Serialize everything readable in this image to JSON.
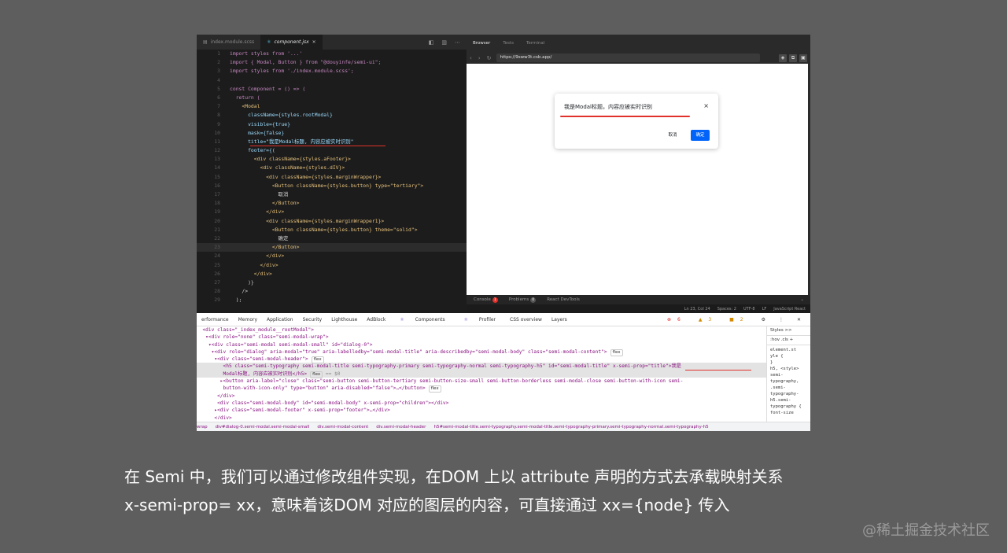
{
  "editor": {
    "tabs": [
      "index.module.scss",
      "component.jsx"
    ],
    "tab_close": "×",
    "lines": [
      {
        "n": "1",
        "text": "import styles from '...'"
      },
      {
        "n": "2",
        "text": "import { Modal, Button } from \"@douyinfe/semi-ui\";"
      },
      {
        "n": "3",
        "text": "import styles from './index.module.scss';"
      },
      {
        "n": "4",
        "text": ""
      },
      {
        "n": "5",
        "text": "const Component = () => ("
      },
      {
        "n": "6",
        "text": "  return ("
      },
      {
        "n": "7",
        "text": "    <Modal"
      },
      {
        "n": "8",
        "text": "      className={styles.rootModal}"
      },
      {
        "n": "9",
        "text": "      visible={true}"
      },
      {
        "n": "10",
        "text": "      mask={false}"
      },
      {
        "n": "11",
        "text": "      title=\"我是Modal标题, 内容应被实时识别\""
      },
      {
        "n": "12",
        "text": "      footer={("
      },
      {
        "n": "13",
        "text": "        <div className={styles.aFooter}>"
      },
      {
        "n": "14",
        "text": "          <div className={styles.dIV}>"
      },
      {
        "n": "15",
        "text": "            <div className={styles.marginWrapper}>"
      },
      {
        "n": "16",
        "text": "              <Button className={styles.button} type=\"tertiary\">"
      },
      {
        "n": "17",
        "text": "                取消"
      },
      {
        "n": "18",
        "text": "              </Button>"
      },
      {
        "n": "19",
        "text": "            </div>"
      },
      {
        "n": "20",
        "text": "            <div className={styles.marginWrapper1}>"
      },
      {
        "n": "21",
        "text": "              <Button className={styles.button} theme=\"solid\">"
      },
      {
        "n": "22",
        "text": "                确定"
      },
      {
        "n": "23",
        "text": "              </Button>"
      },
      {
        "n": "24",
        "text": "            </div>"
      },
      {
        "n": "25",
        "text": "          </div>"
      },
      {
        "n": "26",
        "text": "        </div>"
      },
      {
        "n": "27",
        "text": "      )}"
      },
      {
        "n": "28",
        "text": "    />"
      },
      {
        "n": "29",
        "text": "  );"
      }
    ],
    "highlight_line_index": 22
  },
  "browser": {
    "tabs": [
      "Browser",
      "Tests",
      "Terminal"
    ],
    "url": "https://9sww3t.csb.app/",
    "modal": {
      "title": "我是Modal标题，内容应被实时识别",
      "close": "×",
      "cancel": "取消",
      "ok": "确定"
    },
    "console": {
      "console": "Console",
      "console_badge": "1",
      "problems": "Problems",
      "problems_badge": "0",
      "react": "React DevTools"
    }
  },
  "statusbar": [
    "Ln 23, Col 24",
    "Spaces: 2",
    "UTF-8",
    "LF",
    "JavaScript React"
  ],
  "devtools": {
    "tabs": [
      "erformance",
      "Memory",
      "Application",
      "Security",
      "Lighthouse",
      "AdBlock",
      "Components",
      "Profiler",
      "CSS overview",
      "Layers"
    ],
    "errors": "6",
    "warnings": "3",
    "issues": "2",
    "tree": [
      {
        "indent": "  ",
        "tag": "<div class=\"_index_module__rootModal\">",
        "flex": false
      },
      {
        "indent": "   ",
        "tag": "▾<div role=\"none\" class=\"semi-modal-wrap\">",
        "flex": false
      },
      {
        "indent": "    ",
        "tag": "▾<div class=\"semi-modal semi-modal-small\" id=\"dialog-0\">",
        "flex": false
      },
      {
        "indent": "     ",
        "tag": "▾<div role=\"dialog\" aria-modal=\"true\" aria-labelledby=\"semi-modal-title\" aria-describedby=\"semi-modal-body\" class=\"semi-modal-content\">",
        "flex": true
      },
      {
        "indent": "      ",
        "tag": "▾<div class=\"semi-modal-header\">",
        "flex": true
      },
      {
        "indent": "         ",
        "tag": "<h5 class=\"semi-typography semi-modal-title semi-typography-primary semi-typography-normal semi-typography-h5\" id=\"semi-modal-title\" x-semi-prop=\"title\">我是",
        "flex": false
      },
      {
        "indent": "         ",
        "tag": "Modal标题, 内容应被实时识别</h5>",
        "flex": true
      },
      {
        "indent": "        ",
        "tag": "▸<button aria-label=\"close\" class=\"semi-button semi-button-tertiary semi-button-size-small semi-button-borderless semi-modal-close semi-button-with-icon semi-",
        "flex": false
      },
      {
        "indent": "         ",
        "tag": "button-with-icon-only\" type=\"button\" aria-disabled=\"false\">…</button>",
        "flex": true
      },
      {
        "indent": "       ",
        "tag": "</div>",
        "flex": false
      },
      {
        "indent": "       ",
        "tag": "<div class=\"semi-modal-body\" id=\"semi-modal-body\" x-semi-prop=\"children\"></div>",
        "flex": false
      },
      {
        "indent": "      ",
        "tag": "▸<div class=\"semi-modal-footer\" x-semi-prop=\"footer\">…</div>",
        "flex": false
      },
      {
        "indent": "      ",
        "tag": "</div>",
        "flex": false
      }
    ],
    "flex_label": "flex",
    "eq_label": "== $0",
    "breadcrumbs": [
      "wrap",
      "div#dialog-0.semi-modal.semi-modal-small",
      "div.semi-modal-content",
      "div.semi-modal-header",
      "h5#semi-modal-title.semi-typography.semi-modal-title.semi-typography-primary.semi-typography-normal.semi-typography-h5"
    ],
    "styles_tabs": [
      "Styles",
      ">>"
    ],
    "styles_filter": ":hov .cls +",
    "styles_lines": [
      "element.st",
      "yle {",
      "}",
      "h5,   <style>",
      "semi-",
      "typography,",
      ".semi-",
      "typography-",
      "h5.semi-",
      "typography {",
      "  font-size"
    ]
  },
  "caption": {
    "line1": "在 Semi 中，我们可以通过修改组件实现，在DOM 上以 attribute 声明的方式去承载映射关系",
    "line2": "x-semi-prop= xx，意味着该DOM 对应的图层的内容，可直接通过 xx={node} 传入"
  },
  "watermark": "@稀土掘金技术社区"
}
